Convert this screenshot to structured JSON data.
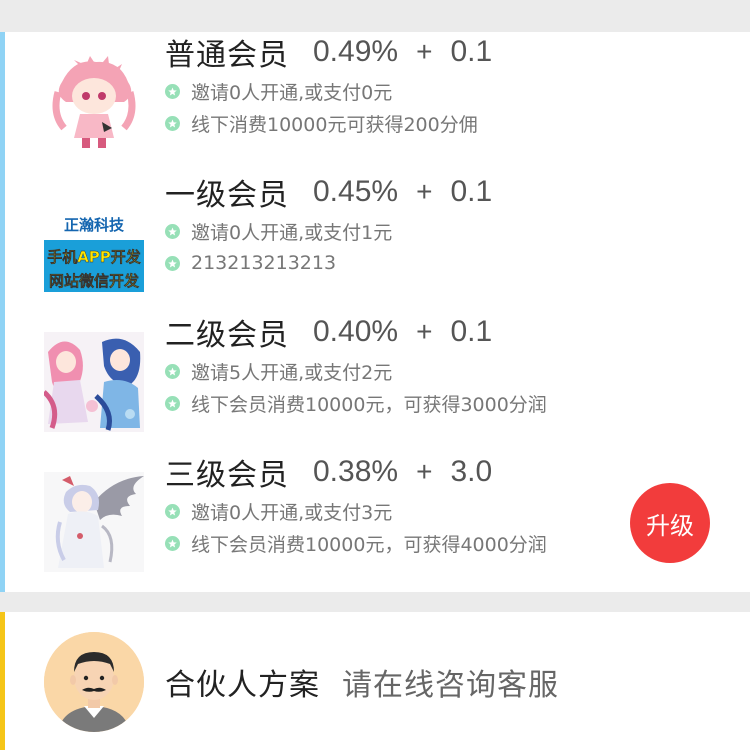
{
  "tiers": [
    {
      "name": "普通会员",
      "rate": "0.49%",
      "plus": "+",
      "bonus": "0.1",
      "line1": "邀请0人开通,或支付0元",
      "line2": "线下消费10000元可获得200分佣",
      "thumb_icon": "pink-anime-character-image"
    },
    {
      "name": "一级会员",
      "rate": "0.45%",
      "plus": "+",
      "bonus": "0.1",
      "line1": "邀请0人开通,或支付1元",
      "line2": "213213213213",
      "thumb_icon": "company-ad-banner-image",
      "banner": {
        "line1": "正瀚科技",
        "line2": "手机APP开发",
        "line3": "网站微信开发"
      }
    },
    {
      "name": "二级会员",
      "rate": "0.40%",
      "plus": "+",
      "bonus": "0.1",
      "line1": "邀请5人开通,或支付2元",
      "line2": "线下会员消费10000元，可获得3000分润",
      "thumb_icon": "two-anime-girls-image"
    },
    {
      "name": "三级会员",
      "rate": "0.38%",
      "plus": "+",
      "bonus": "3.0",
      "line1": "邀请0人开通,或支付3元",
      "line2": "线下会员消费10000元，可获得4000分润",
      "thumb_icon": "winged-anime-girl-image"
    }
  ],
  "upgrade_label": "升级",
  "partner": {
    "title": "合伙人方案",
    "subtitle": "请在线咨询客服",
    "avatar_icon": "mustache-man-avatar"
  },
  "colors": {
    "tier_accent": "#8fd3f5",
    "partner_accent": "#f5c518",
    "bullet": "#97e0b7",
    "upgrade_button": "#f23c3c",
    "section_gap": "#ebebeb"
  }
}
